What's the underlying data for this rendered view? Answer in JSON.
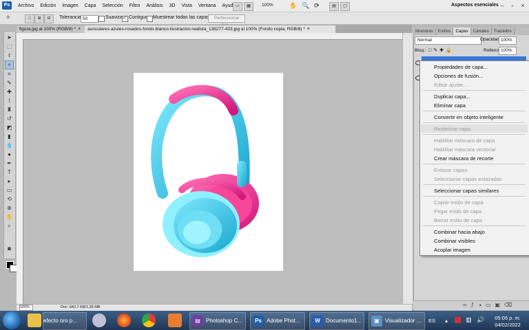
{
  "menubar": {
    "logo": "Ps",
    "items": [
      "Archivo",
      "Edición",
      "Imagen",
      "Capa",
      "Selección",
      "Filtro",
      "Análisis",
      "3D",
      "Vista",
      "Ventana",
      "Ayuda"
    ],
    "zoom": "100%",
    "workspace": "Aspectos esenciales"
  },
  "options": {
    "tolerance_label": "Tolerancia:",
    "tolerance_value": "50",
    "smooth_label": "Suavizar",
    "contiguous_label": "Contiguo",
    "sample_all_label": "Muestrear todas las capas",
    "refine_label": "Perfeccionar bor..."
  },
  "tabs": [
    {
      "label": "figura.jpg al 100% (RGB/8) *",
      "close": "×"
    },
    {
      "label": "auriculares-azules-rosados-fondo-blanco-ilustracion-realista_136277-433.jpg al 100% (Fondo copia, RGB/8) *",
      "close": "×"
    }
  ],
  "status": {
    "zoom": "100%",
    "doc": "Doc: 642,7 KB/1,26 MB"
  },
  "panel": {
    "tabs": [
      "Muestras",
      "Estilos",
      "Capas",
      "Canales",
      "Trazados"
    ],
    "active_tab": "Capas",
    "blend_mode": "Normal",
    "opacity_label": "Opacidad:",
    "opacity_value": "100%",
    "lock_label": "Bloq.:",
    "fill_label": "Relleno:",
    "fill_value": "100%"
  },
  "context_menu": {
    "items": [
      {
        "label": "Propiedades de capa...",
        "enabled": true
      },
      {
        "label": "Opciones de fusión...",
        "enabled": true
      },
      {
        "label": "Editar ajuste...",
        "enabled": false
      },
      {
        "label": "Duplicar capa...",
        "enabled": true
      },
      {
        "label": "Eliminar capa",
        "enabled": true
      },
      {
        "label": "Convertir en objeto inteligente",
        "enabled": true
      },
      {
        "label": "Rasterizar capa",
        "enabled": false
      },
      {
        "label": "Habilitar máscara de capa",
        "enabled": false
      },
      {
        "label": "Habilitar máscara vectorial",
        "enabled": false
      },
      {
        "label": "Crear máscara de recorte",
        "enabled": true
      },
      {
        "label": "Enlazar capas",
        "enabled": false
      },
      {
        "label": "Seleccionar capas enlazadas",
        "enabled": false
      },
      {
        "label": "Seleccionar capas similares",
        "enabled": true
      },
      {
        "label": "Copiar estilo de capa",
        "enabled": false
      },
      {
        "label": "Pegar estilo de capa",
        "enabled": false
      },
      {
        "label": "Borrar estilo de capa",
        "enabled": false
      },
      {
        "label": "Combinar hacia abajo",
        "enabled": true
      },
      {
        "label": "Combinar visibles",
        "enabled": true
      },
      {
        "label": "Acoplar imagen",
        "enabled": true
      }
    ]
  },
  "taskbar": {
    "buttons": [
      {
        "label": "efecto oro p..."
      },
      {
        "label": "Photoshop C..."
      },
      {
        "label": "Adobe Phot..."
      },
      {
        "label": "Documento1..."
      },
      {
        "label": "Visualizador ..."
      }
    ],
    "language": "ES",
    "time": "05:06 p. m.",
    "date": "04/02/2022"
  }
}
